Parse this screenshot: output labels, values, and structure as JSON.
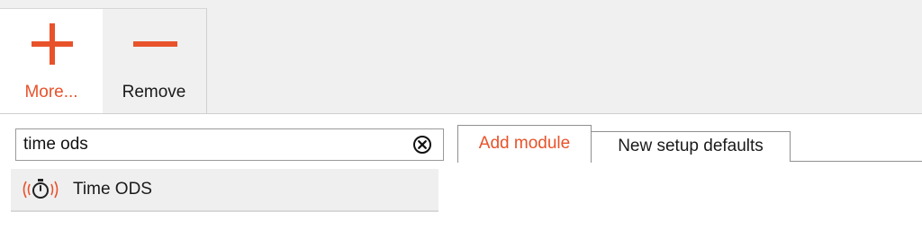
{
  "toolbar": {
    "more_label": "More...",
    "remove_label": "Remove",
    "more_icon": "plus-icon",
    "remove_icon": "minus-icon"
  },
  "search": {
    "value": "time ods",
    "clear_icon": "clear-search-icon"
  },
  "tabs": [
    {
      "label": "Add module",
      "active": true
    },
    {
      "label": "New setup defaults",
      "active": false
    }
  ],
  "results": [
    {
      "label": "Time ODS",
      "icon": "timer-icon"
    }
  ],
  "colors": {
    "accent": "#e8522a",
    "toolbar_bg": "#f0f0f0",
    "item_bg": "#efefef",
    "border": "#8f8f8f"
  }
}
